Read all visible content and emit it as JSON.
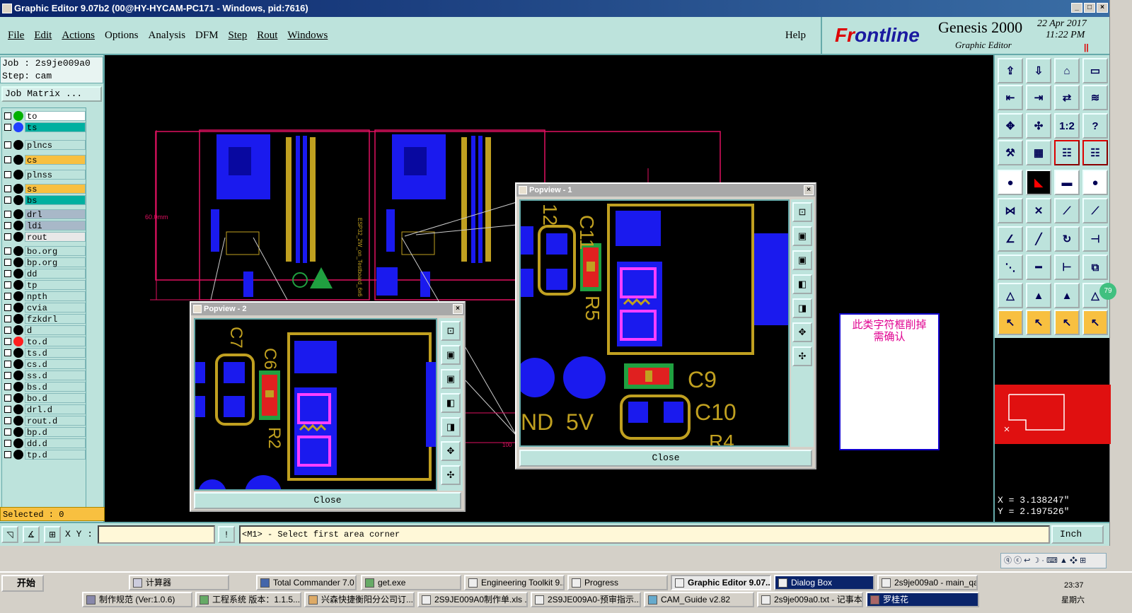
{
  "window": {
    "title": "Graphic Editor 9.07b2 (00@HY-HYCAM-PC171 - Windows, pid:7616)"
  },
  "menu": {
    "items": [
      "File",
      "Edit",
      "Actions",
      "Options",
      "Analysis",
      "DFM",
      "Step",
      "Rout",
      "Windows"
    ],
    "help": "Help"
  },
  "brand": {
    "logo_a": "Fr",
    "logo_b": "ontline",
    "product": "Genesis 2000",
    "subtitle": "Graphic Editor",
    "date": "22 Apr 2017",
    "time": "11:22 PM",
    "pause": "||"
  },
  "job": {
    "job_line": "Job : 2s9je009a0",
    "step_line": "Step: cam",
    "matrix_button": "Job Matrix ..."
  },
  "layers": [
    {
      "name": "to",
      "color": "#00b000",
      "bg": "#ffffff"
    },
    {
      "name": "ts",
      "color": "#2040ff",
      "bg": "#00b0a0"
    },
    {
      "name": "plncs",
      "color": "",
      "bg": "#bde3dc"
    },
    {
      "name": "cs",
      "color": "",
      "bg": "#f8c040"
    },
    {
      "name": "plnss",
      "color": "",
      "bg": "#bde3dc"
    },
    {
      "name": "ss",
      "color": "",
      "bg": "#f8c040"
    },
    {
      "name": "bs",
      "color": "",
      "bg": "#00b0a0"
    },
    {
      "name": "drl",
      "color": "",
      "bg": "#a8b8c8"
    },
    {
      "name": "ldi",
      "color": "",
      "bg": "#a8b8c8"
    },
    {
      "name": "rout",
      "color": "",
      "bg": "#e8e8e8"
    },
    {
      "name": "bo.org",
      "color": "",
      "bg": "#bde3dc"
    },
    {
      "name": "bp.org",
      "color": "",
      "bg": "#bde3dc"
    },
    {
      "name": "dd",
      "color": "",
      "bg": "#bde3dc"
    },
    {
      "name": "tp",
      "color": "",
      "bg": "#bde3dc"
    },
    {
      "name": "npth",
      "color": "",
      "bg": "#bde3dc"
    },
    {
      "name": "cvia",
      "color": "",
      "bg": "#bde3dc"
    },
    {
      "name": "fzkdrl",
      "color": "",
      "bg": "#bde3dc"
    },
    {
      "name": "d",
      "color": "",
      "bg": "#bde3dc"
    },
    {
      "name": "to.d",
      "color": "#ff2020",
      "bg": "#bde3dc"
    },
    {
      "name": "ts.d",
      "color": "",
      "bg": "#bde3dc"
    },
    {
      "name": "cs.d",
      "color": "",
      "bg": "#bde3dc"
    },
    {
      "name": "ss.d",
      "color": "",
      "bg": "#bde3dc"
    },
    {
      "name": "bs.d",
      "color": "",
      "bg": "#bde3dc"
    },
    {
      "name": "bo.d",
      "color": "",
      "bg": "#bde3dc"
    },
    {
      "name": "drl.d",
      "color": "",
      "bg": "#bde3dc"
    },
    {
      "name": "rout.d",
      "color": "",
      "bg": "#bde3dc"
    },
    {
      "name": "bp.d",
      "color": "",
      "bg": "#bde3dc"
    },
    {
      "name": "dd.d",
      "color": "",
      "bg": "#bde3dc"
    },
    {
      "name": "tp.d",
      "color": "",
      "bg": "#bde3dc"
    }
  ],
  "selected": "Selected : 0",
  "canvas": {
    "dim_label": "60.0mm",
    "board_text": "ESP32_2W_on_Testboard_6x6",
    "edge_label": "100"
  },
  "popview1": {
    "title": "Popview - 1",
    "close": "Close",
    "labels": [
      "C11",
      "R5",
      "C9",
      "C10",
      "12",
      "ND",
      "5V",
      "R4"
    ]
  },
  "popview2": {
    "title": "Popview - 2",
    "close": "Close",
    "labels": [
      "C7",
      "C6",
      "R2"
    ]
  },
  "note": {
    "line1": "此类字符框削掉",
    "line2": "需确认"
  },
  "tools": {
    "ratio": "1:2",
    "help": "?",
    "badge": "79"
  },
  "coords": {
    "x": "X = 3.138247\"",
    "y": "Y = 2.197526\""
  },
  "bottom": {
    "xy_label": "X Y :",
    "prompt": "<M1> - Select first area corner",
    "units": "Inch"
  },
  "ime": {
    "text": "ⓠ ⓒ ↩ ☽ · ⌨ ▲ ❖ ⊞"
  },
  "taskbar": {
    "start": "开始",
    "row1": [
      "计算器",
      "Total Commander 7.0 ...",
      "get.exe",
      "Engineering Toolkit 9....",
      "Progress",
      "Graphic Editor 9.07...",
      "Dialog Box",
      "2s9je009a0 - main_qa"
    ],
    "row2": [
      "制作规范 (Ver:1.0.6)",
      "工程系统  版本：1.1.5...",
      "兴森快捷衡阳分公司订...",
      "2S9JE009A0制作单.xls ...",
      "2S9JE009A0-预审指示...",
      "CAM_Guide v2.82",
      "2s9je009a0.txt - 记事本",
      "罗桂花"
    ],
    "time": "23:37",
    "day": "星期六"
  }
}
